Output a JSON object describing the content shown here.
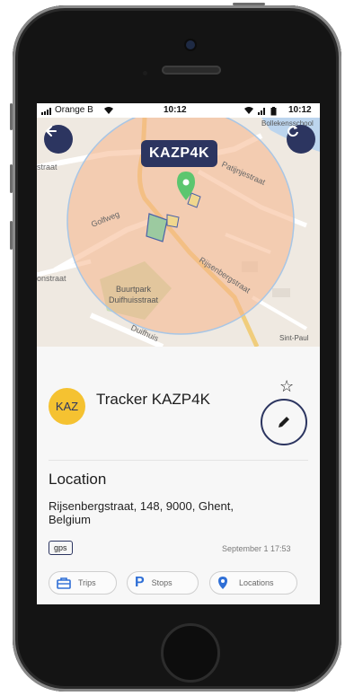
{
  "status_bar": {
    "carrier": "Orange B",
    "time_center": "10:12",
    "time_right": "10:12"
  },
  "map": {
    "plate_label": "KAZP4K",
    "labels": {
      "street_patijnje": "Patijnjestraat",
      "street_golfweg": "Golfweg",
      "street_rijsenberg": "Rijsenbergstraat",
      "street_duifhuis": "Duifhuis",
      "street_onstraat": "onstraat",
      "street_straat": "straat",
      "park_line1": "Buurtpark",
      "park_line2": "Duifhuisstraat",
      "top_right": "Bollekensschool",
      "bottom_right": "Sint-Paul"
    },
    "icons": {
      "back": "arrow-left-icon",
      "refresh": "refresh-icon",
      "marker": "location-pin-icon"
    },
    "colors": {
      "geofence": "#f5b58a",
      "button_bg": "#2c3560"
    }
  },
  "tracker": {
    "avatar_initials": "KAZ",
    "name": "Tracker KAZP4K",
    "avatar_color": "#f5c231"
  },
  "location": {
    "section_title": "Location",
    "address": "Rijsenbergstraat, 148, 9000, Ghent, Belgium",
    "source_badge": "gps",
    "timestamp": "September 1 17:53"
  },
  "actions": [
    {
      "label": "Trips",
      "icon": "briefcase-icon"
    },
    {
      "label": "Stops",
      "icon": "parking-icon"
    },
    {
      "label": "Locations",
      "icon": "location-pin-icon"
    }
  ]
}
